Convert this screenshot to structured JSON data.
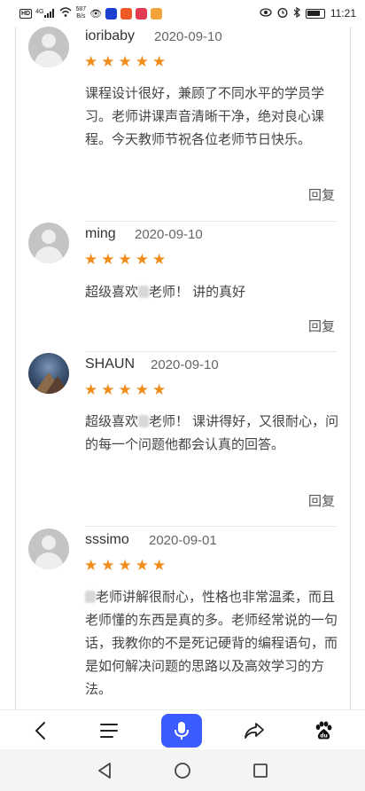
{
  "status_bar": {
    "network_badge": "HD",
    "signal_label": "4G",
    "speed_value": "587",
    "speed_unit": "B/s",
    "time": "11:21"
  },
  "comments": [
    {
      "username": "ioribaby",
      "date": "2020-09-10",
      "stars": "★★★★★",
      "text": "课程设计很好，兼顾了不同水平的学员学习。老师讲课声音清晰干净，绝对良心课程。今天教师节祝各位老师节日快乐。",
      "reply": "回复"
    },
    {
      "username": "ming",
      "date": "2020-09-10",
      "stars": "★★★★★",
      "text_before": "超级喜欢",
      "text_after": "老师！ 讲的真好",
      "reply": "回复"
    },
    {
      "username": "SHAUN",
      "date": "2020-09-10",
      "stars": "★★★★★",
      "text_before": "超级喜欢",
      "text_after": "老师！ 课讲得好，又很耐心，问的每一个问题他都会认真的回答。",
      "reply": "回复"
    },
    {
      "username": "sssimo",
      "date": "2020-09-01",
      "stars": "★★★★★",
      "text_after": "老师讲解很耐心，性格也非常温柔，而且老师懂的东西是真的多。老师经常说的一句话，我教你的不是死记硬背的编程语句，而是如何解决问题的思路以及高效学习的方法。"
    }
  ],
  "toolbar_icons": [
    "back-icon",
    "menu-icon",
    "microphone-icon",
    "share-icon",
    "baidu-paw-icon"
  ],
  "nav_icons": [
    "back-triangle-icon",
    "home-circle-icon",
    "recents-square-icon"
  ],
  "colors": {
    "star": "#f08c1a",
    "mic_button": "#3d5cff"
  }
}
